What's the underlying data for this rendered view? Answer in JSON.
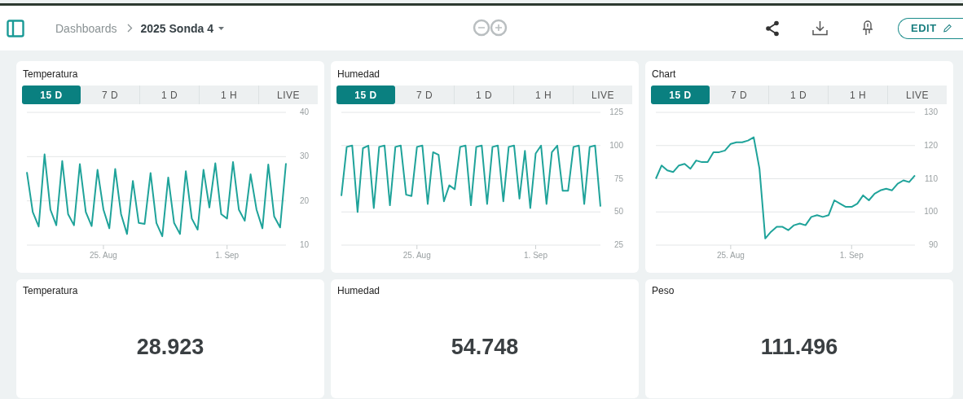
{
  "header": {
    "breadcrumb": [
      {
        "label": "Dashboards"
      },
      {
        "label": "2025 Sonda 4"
      }
    ],
    "edit_button": "EDIT"
  },
  "charts": [
    {
      "title": "Temperatura",
      "ranges": [
        {
          "label": "15 D",
          "selected": true
        },
        {
          "label": "7 D",
          "selected": false
        },
        {
          "label": "1 D",
          "selected": false
        },
        {
          "label": "1 H",
          "selected": false
        },
        {
          "label": "LIVE",
          "selected": false
        }
      ],
      "chart_data": {
        "type": "line",
        "categories": [
          null,
          null,
          null,
          null,
          null,
          null,
          null,
          null,
          null,
          null,
          null,
          null,
          null,
          "25. Aug",
          null,
          null,
          null,
          null,
          null,
          null,
          null,
          null,
          null,
          null,
          null,
          null,
          null,
          null,
          null,
          null,
          null,
          null,
          null,
          null,
          "1. Sep",
          null,
          null,
          null,
          null,
          null,
          null,
          null,
          null,
          null,
          null
        ],
        "values": [
          26.5,
          17.5,
          14.2,
          30.5,
          18,
          14.5,
          29,
          17,
          14.5,
          28.3,
          17.5,
          14.3,
          27,
          18,
          13.8,
          27.2,
          17,
          12.5,
          24.5,
          15,
          14.8,
          26.3,
          15,
          12,
          25.3,
          15,
          12.5,
          26.7,
          16,
          13.5,
          27,
          18.5,
          28.5,
          17,
          16,
          28.8,
          18,
          15.5,
          26,
          18,
          13.8,
          28.2,
          16.5,
          14,
          28.5
        ],
        "grid": true,
        "ylim": [
          10,
          40
        ],
        "yticks": [
          10,
          20,
          30,
          40
        ]
      }
    },
    {
      "title": "Humedad",
      "ranges": [
        {
          "label": "15 D",
          "selected": true
        },
        {
          "label": "7 D",
          "selected": false
        },
        {
          "label": "1 D",
          "selected": false
        },
        {
          "label": "1 H",
          "selected": false
        },
        {
          "label": "LIVE",
          "selected": false
        }
      ],
      "chart_data": {
        "type": "line",
        "categories": [
          null,
          null,
          null,
          null,
          null,
          null,
          null,
          null,
          null,
          null,
          null,
          null,
          null,
          null,
          "25. Aug",
          null,
          null,
          null,
          null,
          null,
          null,
          null,
          null,
          null,
          null,
          null,
          null,
          null,
          null,
          null,
          null,
          null,
          null,
          null,
          null,
          null,
          "1. Sep",
          null,
          null,
          null,
          null,
          null,
          null,
          null,
          null,
          null,
          null,
          null,
          null
        ],
        "values": [
          62,
          99,
          100,
          50,
          98,
          100,
          53,
          99,
          100,
          55,
          99,
          100,
          63,
          62,
          99,
          100,
          56,
          95,
          93,
          58,
          70,
          67,
          99,
          100,
          55,
          99,
          100,
          56,
          99,
          100,
          58,
          99,
          100,
          60,
          96,
          53,
          94,
          100,
          56,
          95,
          100,
          66,
          66,
          99,
          100,
          56,
          99,
          100,
          54
        ],
        "grid": true,
        "ylim": [
          25,
          125
        ],
        "yticks": [
          25,
          50,
          75,
          100,
          125
        ]
      }
    },
    {
      "title": "Chart",
      "ranges": [
        {
          "label": "15 D",
          "selected": true
        },
        {
          "label": "7 D",
          "selected": false
        },
        {
          "label": "1 D",
          "selected": false
        },
        {
          "label": "1 H",
          "selected": false
        },
        {
          "label": "LIVE",
          "selected": false
        }
      ],
      "chart_data": {
        "type": "line",
        "categories": [
          null,
          null,
          null,
          null,
          null,
          null,
          null,
          null,
          null,
          null,
          null,
          null,
          null,
          "25. Aug",
          null,
          null,
          null,
          null,
          null,
          null,
          null,
          null,
          null,
          null,
          null,
          null,
          null,
          null,
          null,
          null,
          null,
          null,
          null,
          null,
          "1. Sep",
          null,
          null,
          null,
          null,
          null,
          null,
          null,
          null,
          null,
          null,
          null
        ],
        "values": [
          110,
          114,
          112.5,
          112,
          114,
          114.5,
          113,
          115.5,
          115,
          115,
          118,
          118,
          118.5,
          120.5,
          121,
          121,
          121.5,
          122.5,
          113,
          92,
          94,
          95.5,
          95.5,
          94.5,
          96,
          96.5,
          96,
          98.5,
          99,
          98.5,
          99,
          103.5,
          102.5,
          101.5,
          101.5,
          102.5,
          105,
          103.5,
          105.5,
          106.5,
          107,
          106.5,
          108.5,
          109.5,
          109,
          111
        ],
        "grid": true,
        "ylim": [
          90,
          130
        ],
        "yticks": [
          90,
          100,
          110,
          120,
          130
        ]
      }
    }
  ],
  "values": [
    {
      "title": "Temperatura",
      "value": "28.923"
    },
    {
      "title": "Humedad",
      "value": "54.748"
    },
    {
      "title": "Peso",
      "value": "111.496"
    }
  ]
}
